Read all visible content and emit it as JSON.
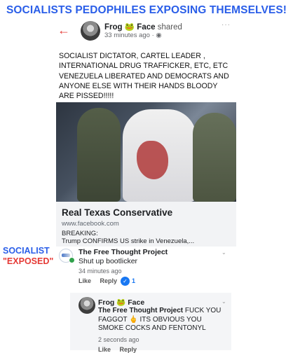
{
  "banner": "SOCIALISTS PEDOPHILES EXPOSING THEMSELVES!",
  "post": {
    "author": "Frog",
    "emoji": "🐸",
    "author_suffix": "Face",
    "action": "shared",
    "time": "33 minutes ago ·",
    "privacy_icon": "globe-icon",
    "text": "SOCIALIST DICTATOR,  CARTEL LEADER , INTERNATIONAL DRUG TRAFFICKER, ETC, ETC VENEZUELA LIBERATED AND DEMOCRATS AND ANYONE ELSE WITH THEIR HANDS BLOODY ARE PISSED!!!!!",
    "link": {
      "title": "Real Texas Conservative",
      "domain": "www.facebook.com",
      "desc_line1": "BREAKING:",
      "desc_line2": "Trump CONFIRMS US strike in Venezuela,..."
    }
  },
  "annotation": {
    "line1": "SOCIALIST",
    "line2": "\"EXPOSED\""
  },
  "comment": {
    "author": "The Free Thought Project",
    "text": "Shut up bootlicker",
    "time": "34 minutes ago",
    "like_label": "Like",
    "reply_label": "Reply",
    "like_count": "1"
  },
  "reply": {
    "author": "Frog",
    "emoji": "🐸",
    "author_suffix": "Face",
    "mention": "The Free Thought Project",
    "text": " FUCK YOU FAGGOT 🖕 ITS OBVIOUS YOU SMOKE COCKS AND FENTONYL",
    "time": "2 seconds ago",
    "like_label": "Like",
    "reply_label": "Reply"
  },
  "colors": {
    "banner": "#2a5ee8",
    "accent_red": "#e53935",
    "like_blue": "#1877f2",
    "online_green": "#31a24c"
  }
}
